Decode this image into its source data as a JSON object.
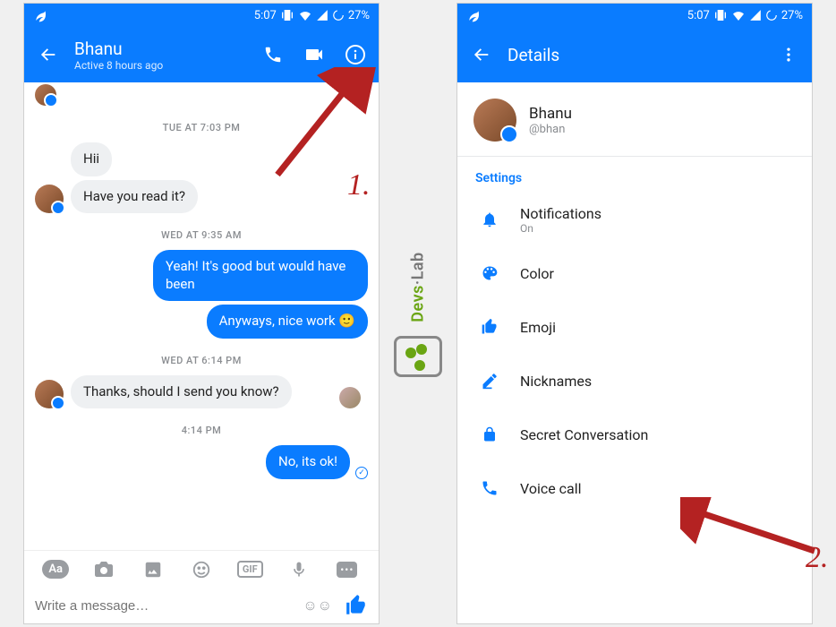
{
  "status": {
    "time": "5:07",
    "battery": "27%"
  },
  "chat": {
    "header": {
      "name": "Bhanu",
      "presence": "Active 8 hours ago"
    },
    "timestamps": {
      "t1": "TUE AT 7:03 PM",
      "t2": "WED AT 9:35 AM",
      "t3": "WED AT 6:14 PM",
      "t4": "4:14 PM"
    },
    "messages": {
      "m1": "Hii",
      "m2": "Have you read it?",
      "m3": "Yeah! It's good but would have been",
      "m4": "Anyways, nice work 🙂",
      "m5": "Thanks, should I send you know?",
      "m6": "No, its ok!"
    },
    "composer": {
      "placeholder": "Write a message…"
    }
  },
  "details": {
    "header": {
      "title": "Details"
    },
    "profile": {
      "name": "Bhanu",
      "handle": "@bhan"
    },
    "section": "Settings",
    "rows": {
      "notifications": {
        "label": "Notifications",
        "sub": "On"
      },
      "color": {
        "label": "Color"
      },
      "emoji": {
        "label": "Emoji"
      },
      "nicknames": {
        "label": "Nicknames"
      },
      "secret": {
        "label": "Secret Conversation"
      },
      "voice": {
        "label": "Voice call"
      }
    }
  },
  "annotations": {
    "a1": "1.",
    "a2": "2."
  },
  "watermark": {
    "text_main": "Devs",
    "text_sub": "Lab"
  }
}
